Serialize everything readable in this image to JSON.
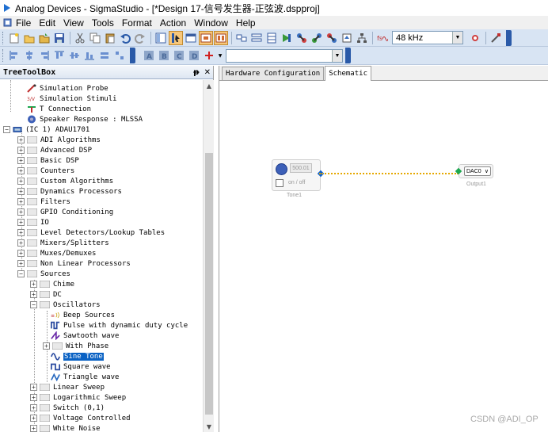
{
  "window": {
    "title": "Analog Devices - SigmaStudio - [*Design 17-信号发生器-正弦波.dspproj]"
  },
  "menu": {
    "items": [
      "File",
      "Edit",
      "View",
      "Tools",
      "Format",
      "Action",
      "Window",
      "Help"
    ]
  },
  "toolbar": {
    "sample_rate": "48 kHz"
  },
  "toolbox": {
    "title": "TreeToolBox",
    "pin_glyph": "ᵽ",
    "close_glyph": "✕",
    "items": [
      {
        "label": "Simulation Probe"
      },
      {
        "label": "Simulation Stimuli"
      },
      {
        "label": "T Connection"
      },
      {
        "label": "Speaker Response : MLSSA"
      },
      {
        "label": "(IC 1) ADAU1701"
      },
      {
        "label": "ADI Algorithms"
      },
      {
        "label": "Advanced DSP"
      },
      {
        "label": "Basic DSP"
      },
      {
        "label": "Counters"
      },
      {
        "label": "Custom Algorithms"
      },
      {
        "label": "Dynamics Processors"
      },
      {
        "label": "Filters"
      },
      {
        "label": "GPIO Conditioning"
      },
      {
        "label": "IO"
      },
      {
        "label": "Level Detectors/Lookup Tables"
      },
      {
        "label": "Mixers/Splitters"
      },
      {
        "label": "Muxes/Demuxes"
      },
      {
        "label": "Non Linear Processors"
      },
      {
        "label": "Sources"
      },
      {
        "label": "Chime"
      },
      {
        "label": "DC"
      },
      {
        "label": "Oscillators"
      },
      {
        "label": "Beep Sources"
      },
      {
        "label": "Pulse with dynamic duty cycle"
      },
      {
        "label": "Sawtooth wave"
      },
      {
        "label": "With Phase"
      },
      {
        "label": "Sine Tone"
      },
      {
        "label": "Square wave"
      },
      {
        "label": "Triangle wave"
      },
      {
        "label": "Linear Sweep"
      },
      {
        "label": "Logarithmic Sweep"
      },
      {
        "label": "Switch (0,1)"
      },
      {
        "label": "Voltage Controlled"
      },
      {
        "label": "White Noise"
      }
    ]
  },
  "tabs": [
    "Hardware Configuration",
    "Schematic"
  ],
  "schematic": {
    "tone": {
      "freq": "500.01",
      "onoff_label": "on / off",
      "name": "Tone1"
    },
    "output": {
      "selection": "DAC0",
      "name": "Output1"
    }
  },
  "watermark": "CSDN @ADI_OP",
  "colors": {
    "toolbar_bg": "#d8e4f3",
    "selection": "#0a62c4",
    "wire": "#e6a800",
    "tone_icon": "#3d60b8"
  }
}
